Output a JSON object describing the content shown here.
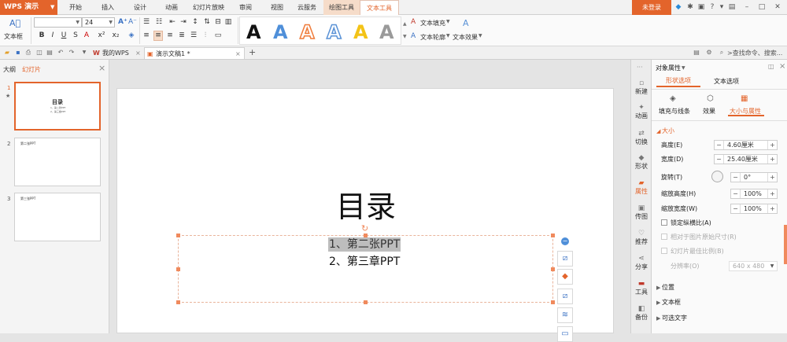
{
  "app": {
    "name": "WPS 演示",
    "login": "未登录"
  },
  "menu_tabs": [
    "开始",
    "插入",
    "设计",
    "动画",
    "幻灯片放映",
    "审阅",
    "视图",
    "云服务",
    "绘图工具",
    "文本工具"
  ],
  "ribbon": {
    "textbox_label": "文本框",
    "font_name": "",
    "font_size": "24",
    "bold": "B",
    "italic": "I",
    "underline": "U",
    "strike": "S",
    "wordart_letter": "A",
    "text_fill": "文本填充",
    "text_outline": "文本轮廓",
    "text_effect": "文本效果"
  },
  "quick_access": {
    "tab_mywps": "我的WPS",
    "tab_doc": "演示文稿1 *",
    "search": ">查找命令、搜索..."
  },
  "left_panel": {
    "tab_outline": "大纲",
    "tab_slides": "幻灯片",
    "slides": [
      {
        "num": "1",
        "title": "目录",
        "lines": [
          "1、第二张PPT",
          "2、第三章PPT"
        ]
      },
      {
        "num": "2",
        "title": "第二张PPT",
        "lines": []
      },
      {
        "num": "3",
        "title": "第三张PPT",
        "lines": []
      }
    ]
  },
  "slide": {
    "title": "目录",
    "line1": "1、第二张PPT",
    "line2": "2、第三章PPT"
  },
  "side_strip": [
    "新建",
    "动画",
    "切换",
    "形状",
    "属性",
    "传图",
    "推荐",
    "分享",
    "工具",
    "备份"
  ],
  "props": {
    "header": "对象属性",
    "tab_shape": "形状选项",
    "tab_text": "文本选项",
    "sub_fill": "填充与线条",
    "sub_effect": "效果",
    "sub_size": "大小与属性",
    "section_size": "大小",
    "height_label": "高度(E)",
    "height_value": "4.60厘米",
    "width_label": "宽度(D)",
    "width_value": "25.40厘米",
    "rotate_label": "旋转(T)",
    "rotate_value": "0°",
    "scale_h_label": "缩放高度(H)",
    "scale_h_value": "100%",
    "scale_w_label": "缩放宽度(W)",
    "scale_w_value": "100%",
    "lock_ratio": "锁定纵横比(A)",
    "relative_orig": "相对于图片原始尺寸(R)",
    "best_scale": "幻灯片最佳比例(B)",
    "resolution_label": "分辨率(O)",
    "resolution_value": "640 x 480",
    "section_position": "位置",
    "section_textbox": "文本框",
    "section_alt": "可选文字"
  }
}
